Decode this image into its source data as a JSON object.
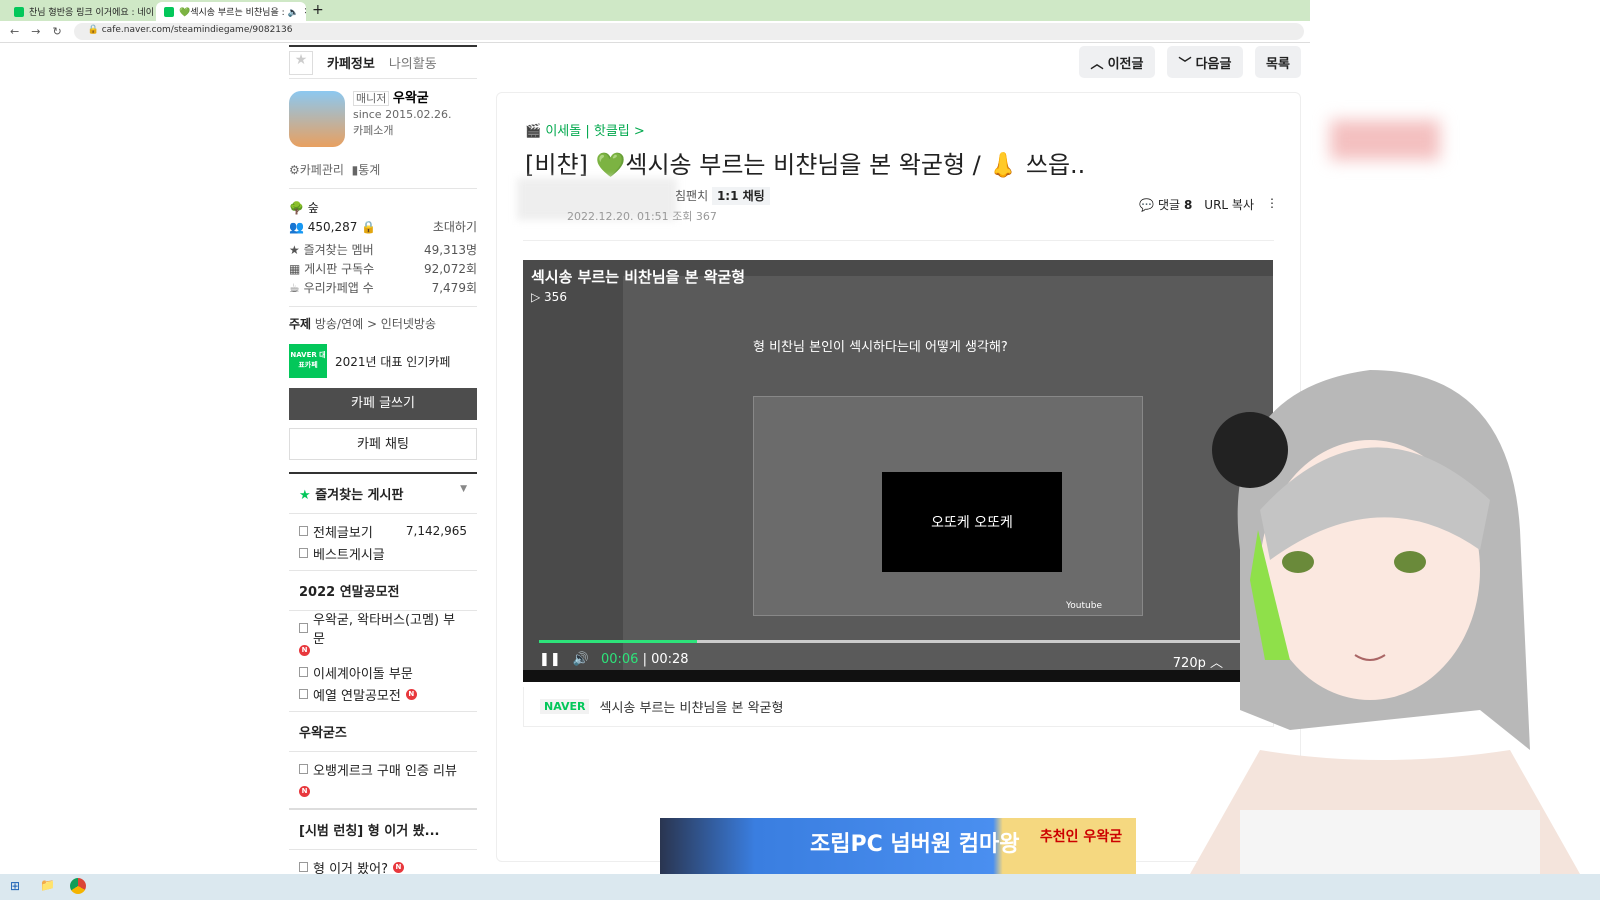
{
  "browser": {
    "tabs": [
      {
        "title": "찬님 형반응 링크 이거에요 : 네이"
      },
      {
        "title": "💚섹시송 부르는 비챤님을 : 🔈"
      }
    ],
    "new_tab": "+",
    "url": "cafe.naver.com/steamindiegame/9082136"
  },
  "sidebar": {
    "tab_info": "카페정보",
    "tab_activity": "나의활동",
    "manager_label": "매니저",
    "manager": "우왁굳",
    "since": "since 2015.02.26.",
    "intro": "카페소개",
    "manage": "카페관리",
    "stats": "통계",
    "level": "숲",
    "members": "450,287",
    "invite": "초대하기",
    "stat_rows": [
      {
        "label": "즐겨찾는 멤버",
        "value": "49,313명"
      },
      {
        "label": "게시판 구독수",
        "value": "92,072회"
      },
      {
        "label": "우리카페앱 수",
        "value": "7,479회"
      }
    ],
    "topic_label": "주제",
    "topic": "방송/연예 > 인터넷방송",
    "award_badge": "NAVER 대표카페",
    "award": "2021년 대표 인기카페",
    "write": "카페 글쓰기",
    "chat": "카페 채팅",
    "fav_boards": "즐겨찾는 게시판",
    "boards": [
      {
        "label": "전체글보기",
        "count": "7,142,965"
      },
      {
        "label": "베스트게시글"
      }
    ],
    "sections": [
      {
        "title": "2022 연말공모전",
        "items": [
          {
            "label": "우왁굳, 왁타버스(고멤) 부문",
            "new": true
          },
          {
            "label": "이세계아이돌 부문"
          },
          {
            "label": "예열 연말공모전",
            "new": true
          }
        ]
      },
      {
        "title": "우왁굳즈",
        "items": [
          {
            "label": "오뱅게르크 구매 인증 리뷰",
            "new": true
          }
        ]
      },
      {
        "title": "[시범 런칭] 형 이거 봤...",
        "items": [
          {
            "label": "형 이거 봤어?",
            "new": true
          }
        ]
      }
    ],
    "new_mark": "N"
  },
  "nav": {
    "prev": "이전글",
    "next": "다음글",
    "list": "목록"
  },
  "article": {
    "breadcrumb": "이세돌 | 핫클립 >",
    "title": "[비챤] 💚섹시송 부르는 비챤님을 본 왁굳형 / 👃 쓰읍..",
    "author_suffix": "침팬치",
    "chat": "1:1 채팅",
    "date": "2022.12.20. 01:51",
    "views": "조회 367",
    "comments_label": "댓글",
    "comments": "8",
    "url_copy": "URL 복사"
  },
  "video": {
    "title": "섹시송 부르는 비찬님을 본 왁굳형",
    "plays": "▷ 356",
    "current": "00:06",
    "duration": "00:28",
    "quality": "720p",
    "progress": 0.22,
    "inner_caption": "오또케 오또케",
    "inner_question": "형 비찬님 본인이 섹시하다는데 어떻게 생각해?",
    "inner_brand": "Youtube",
    "source": "NAVER",
    "caption": "섹시송 부르는 비챤님을 본 왁굳형"
  },
  "banner": {
    "text": "조립PC 넘버원 컴마왕",
    "tag": "추천인 우왁굳"
  },
  "colors": {
    "accent": "#03c75a",
    "progress": "#2de37a"
  }
}
